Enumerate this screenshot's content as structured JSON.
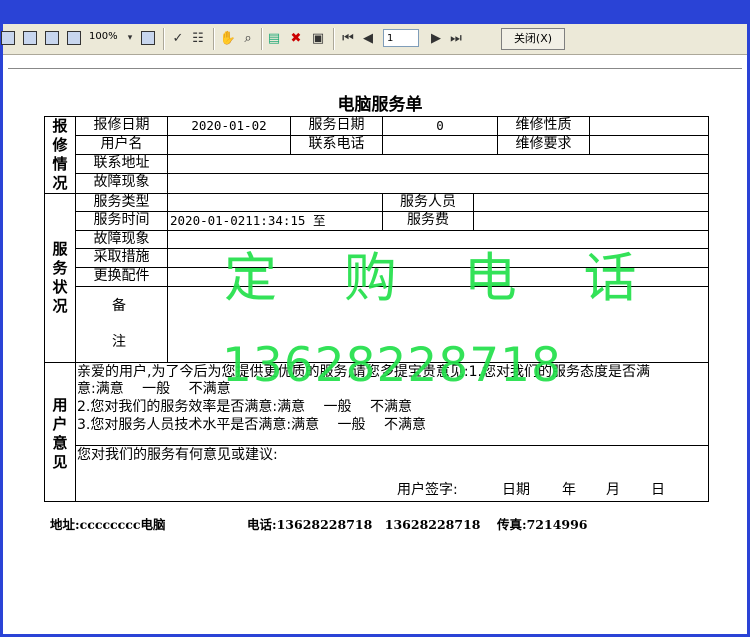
{
  "toolbar": {
    "zoom": "100%",
    "page_number": "1",
    "close_label": "关闭(X)"
  },
  "form": {
    "title": "电脑服务单",
    "sections": {
      "repair_status": [
        "报",
        "修",
        "情",
        "况"
      ],
      "service_status": [
        "服",
        "务",
        "状",
        "况"
      ],
      "user_opinion": [
        "用",
        "户",
        "意",
        "见"
      ]
    },
    "labels": {
      "repair_date": "报修日期",
      "service_date": "服务日期",
      "repair_type": "维修性质",
      "user_name": "用户名",
      "contact_phone": "联系电话",
      "repair_request": "维修要求",
      "contact_address": "联系地址",
      "fault_symptom": "故障现象",
      "service_type": "服务类型",
      "service_staff": "服务人员",
      "service_time": "服务时间",
      "service_fee": "服务费",
      "fault_symptom2": "故障现象",
      "measures": "采取措施",
      "replaced_parts": "更换配件",
      "remarks_1": "备",
      "remarks_2": "注"
    },
    "values": {
      "repair_date": "2020-01-02",
      "service_days": "0",
      "service_time": "2020-01-0211:34:15 至"
    },
    "survey": {
      "intro": "亲爱的用户,为了今后为您提供更优质的服务,请您多提宝贵意见:1.您对我们的服务态度是否满",
      "q1_tail": "意:满意　 一般 　不满意",
      "q2": "2.您对我们的服务效率是否满意:满意 　一般 　不满意",
      "q3": "3.您对服务人员技术水平是否满意:满意 　一般 　不满意",
      "suggest": "您对我们的服务有何意见或建议:",
      "sign": "用户签字:",
      "date_label": "日期",
      "year": "年",
      "month": "月",
      "day": "日"
    }
  },
  "watermark": {
    "line1": "定 购 电 话",
    "line2": "13628228718",
    "color": "#22e04a"
  },
  "footer": {
    "address": "地址:cccccccc电脑",
    "phone": "电话:13628228718　13628228718",
    "fax": "传真:7214996"
  }
}
